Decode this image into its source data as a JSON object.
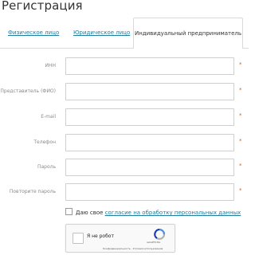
{
  "page_title": "Регистрация",
  "tabs": [
    {
      "label": "Физическое лицо",
      "active": false
    },
    {
      "label": "Юридическое лицо",
      "active": false
    },
    {
      "label": "Индивидуальный предприниматель",
      "active": true
    }
  ],
  "fields": [
    {
      "label": "ИНН",
      "value": "",
      "required_mark": "*"
    },
    {
      "label": "Представитель (ФИО)",
      "value": "",
      "required_mark": "*"
    },
    {
      "label": "E-mail",
      "value": "",
      "required_mark": "*"
    },
    {
      "label": "Телефон",
      "value": "",
      "required_mark": "*"
    },
    {
      "label": "Пароль",
      "value": "",
      "required_mark": "*"
    },
    {
      "label": "Повторите пароль",
      "value": "",
      "required_mark": "*"
    }
  ],
  "consent": {
    "text": "Даю свое",
    "link_text": "согласие на обработку персональных данных",
    "checked": false
  },
  "captcha": {
    "label": "Я не робот",
    "brand": "reCAPTCHA",
    "terms": "Конфиденциальность - Условия использования"
  },
  "colors": {
    "link": "#1f7ea0",
    "required": "#e05a1e",
    "border": "#cfcfcf"
  }
}
